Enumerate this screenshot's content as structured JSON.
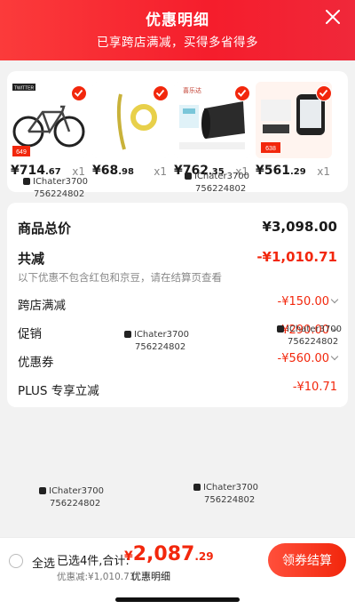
{
  "header": {
    "title": "优惠明细",
    "subtitle": "已享跨店满减，买得多省得多"
  },
  "items": [
    {
      "price_int": "¥714",
      "price_dec": ".67",
      "qty": "x1",
      "image": "bicycle",
      "brand_text": "TWITTER",
      "badge_text": "649"
    },
    {
      "price_int": "¥68",
      "price_dec": ".98",
      "qty": "x1",
      "image": "resistance-band"
    },
    {
      "price_int": "¥762",
      "price_dec": ".35",
      "qty": "x1",
      "image": "floor-mat",
      "brand_text": "喜乐达"
    },
    {
      "price_int": "¥561",
      "price_dec": ".29",
      "qty": "x1",
      "image": "bike-computer",
      "badge_text": "638"
    }
  ],
  "summary": {
    "total_label": "商品总价",
    "total_value": "¥3,098.00",
    "discount_label": "共减",
    "discount_value": "-¥1,010.71",
    "note": "以下优惠不包含红包和京豆，请在结算页查看",
    "rows": [
      {
        "label": "跨店满减",
        "value": "-¥150.00"
      },
      {
        "label": "促销",
        "value": "-¥290.00"
      },
      {
        "label": "优惠券",
        "value": "-¥560.00"
      },
      {
        "label": "PLUS 专享立减",
        "value": "-¥10.71"
      }
    ]
  },
  "bottom": {
    "select_all": "全选",
    "selected_count": "已选4件,合计:",
    "total_currency": "¥",
    "total_int": "2,087",
    "total_dec": ".29",
    "discount_text": "优惠减:¥1,010.71",
    "detail_link": "优惠明细",
    "checkout_label": "领券结算"
  },
  "watermark": {
    "user": "IChater3700",
    "id": "756224802"
  },
  "colors": {
    "accent": "#f2270c",
    "header": "#f51d2c"
  }
}
